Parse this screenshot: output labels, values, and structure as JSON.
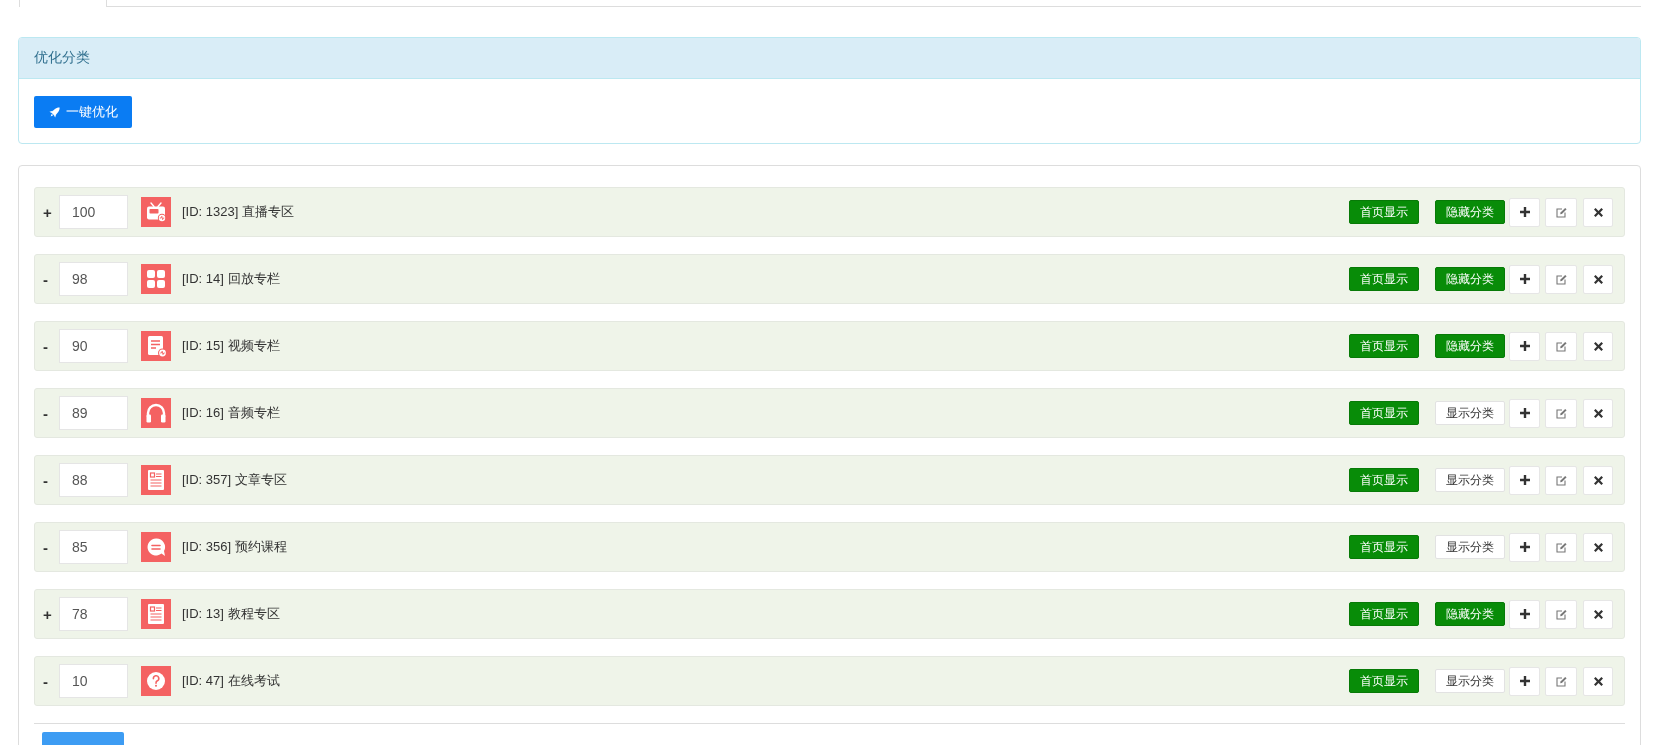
{
  "optimize_panel": {
    "title": "优化分类",
    "button": "一键优化"
  },
  "categories": [
    {
      "toggle": "+",
      "sort": "100",
      "kind": "live",
      "label": "[ID: 1323] 直播专区",
      "home_button": {
        "label": "首页显示",
        "on": true
      },
      "visibility_button": {
        "label": "隐藏分类",
        "on": true
      }
    },
    {
      "toggle": "-",
      "sort": "98",
      "kind": "grid",
      "label": "[ID: 14] 回放专栏",
      "home_button": {
        "label": "首页显示",
        "on": true
      },
      "visibility_button": {
        "label": "隐藏分类",
        "on": true
      }
    },
    {
      "toggle": "-",
      "sort": "90",
      "kind": "video",
      "label": "[ID: 15] 视频专栏",
      "home_button": {
        "label": "首页显示",
        "on": true
      },
      "visibility_button": {
        "label": "隐藏分类",
        "on": true
      }
    },
    {
      "toggle": "-",
      "sort": "89",
      "kind": "audio",
      "label": "[ID: 16] 音频专栏",
      "home_button": {
        "label": "首页显示",
        "on": true
      },
      "visibility_button": {
        "label": "显示分类",
        "on": false
      }
    },
    {
      "toggle": "-",
      "sort": "88",
      "kind": "article",
      "label": "[ID: 357] 文章专区",
      "home_button": {
        "label": "首页显示",
        "on": true
      },
      "visibility_button": {
        "label": "显示分类",
        "on": false
      }
    },
    {
      "toggle": "-",
      "sort": "85",
      "kind": "chat",
      "label": "[ID: 356] 预约课程",
      "home_button": {
        "label": "首页显示",
        "on": true
      },
      "visibility_button": {
        "label": "显示分类",
        "on": false
      }
    },
    {
      "toggle": "+",
      "sort": "78",
      "kind": "article",
      "label": "[ID: 13] 教程专区",
      "home_button": {
        "label": "首页显示",
        "on": true
      },
      "visibility_button": {
        "label": "隐藏分类",
        "on": true
      }
    },
    {
      "toggle": "-",
      "sort": "10",
      "kind": "question",
      "label": "[ID: 47] 在线考试",
      "home_button": {
        "label": "首页显示",
        "on": true
      },
      "visibility_button": {
        "label": "显示分类",
        "on": false
      }
    }
  ]
}
